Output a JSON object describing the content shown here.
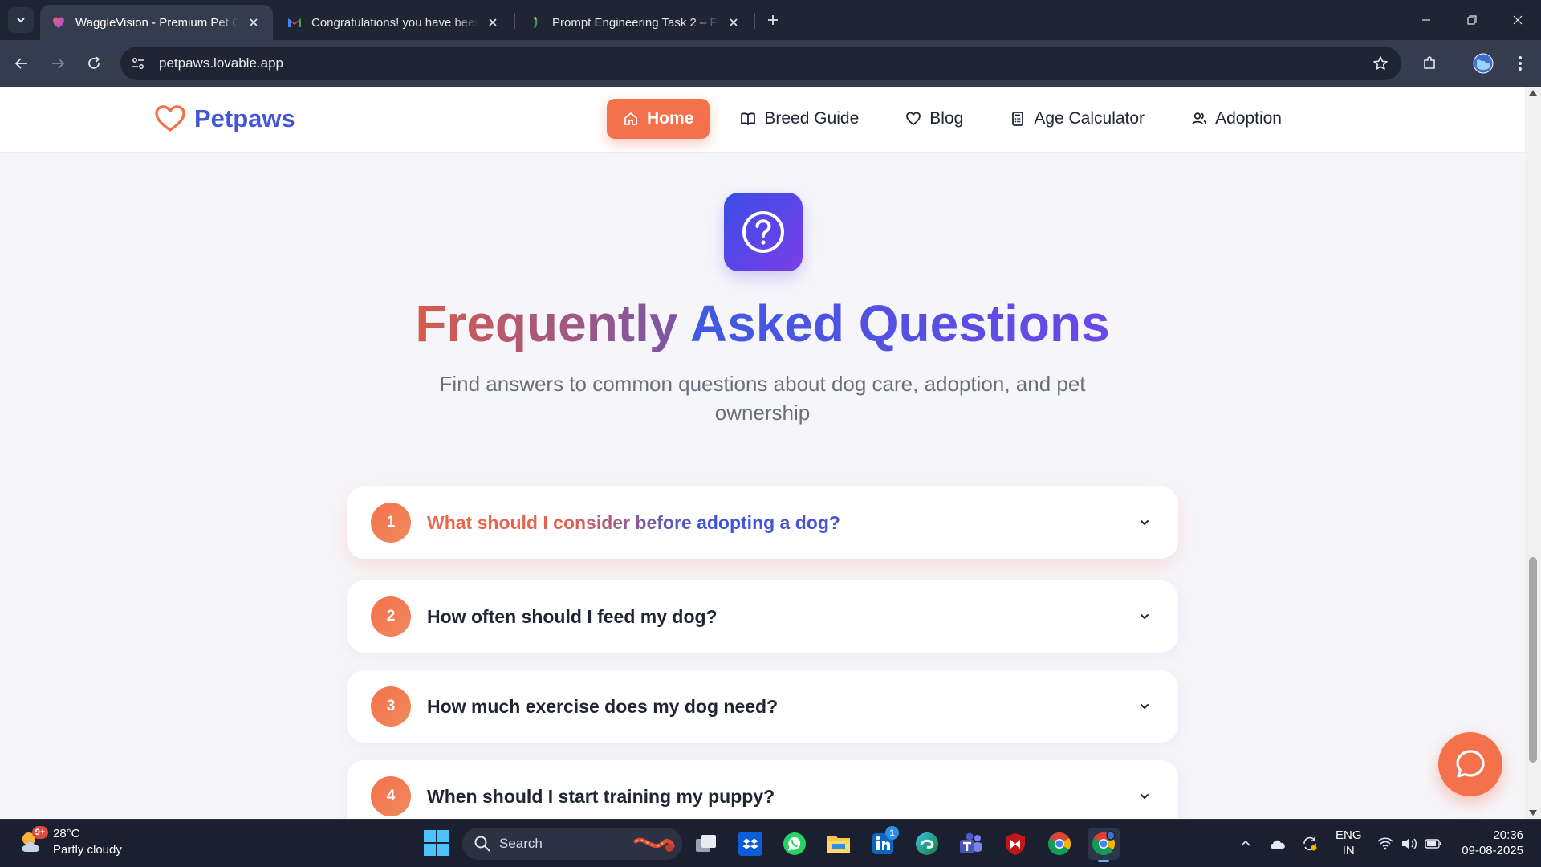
{
  "browser": {
    "tabs": [
      {
        "title": "WaggleVision - Premium Pet Ca",
        "active": true
      },
      {
        "title": "Congratulations! you have been",
        "active": false
      },
      {
        "title": "Prompt Engineering Task 2 – Fu",
        "active": false
      }
    ],
    "url": "petpaws.lovable.app"
  },
  "site": {
    "brand": "Petpaws",
    "nav": [
      {
        "label": "Home",
        "icon": "home-icon",
        "active": true
      },
      {
        "label": "Breed Guide",
        "icon": "book-icon",
        "active": false
      },
      {
        "label": "Blog",
        "icon": "heart-icon",
        "active": false
      },
      {
        "label": "Age Calculator",
        "icon": "calculator-icon",
        "active": false
      },
      {
        "label": "Adoption",
        "icon": "users-icon",
        "active": false
      }
    ]
  },
  "faq": {
    "title_part1": "Frequently",
    "title_part2": "Asked Questions",
    "subtitle": "Find answers to common questions about dog care, adoption, and pet ownership",
    "items": [
      {
        "number": "1",
        "question": "What should I consider before adopting a dog?",
        "open": true
      },
      {
        "number": "2",
        "question": "How often should I feed my dog?",
        "open": false
      },
      {
        "number": "3",
        "question": "How much exercise does my dog need?",
        "open": false
      },
      {
        "number": "4",
        "question": "When should I start training my puppy?",
        "open": false
      }
    ]
  },
  "colors": {
    "accent_orange": "#f5714b",
    "brand_blue": "#4357d6",
    "gradient_purple": "#7a3ee8"
  },
  "taskbar": {
    "weather_temp": "28°C",
    "weather_desc": "Partly cloudy",
    "weather_badge": "9+",
    "search_label": "Search",
    "linkedin_badge": "1",
    "lang_line1": "ENG",
    "lang_line2": "IN",
    "time": "20:36",
    "date": "09-08-2025"
  }
}
